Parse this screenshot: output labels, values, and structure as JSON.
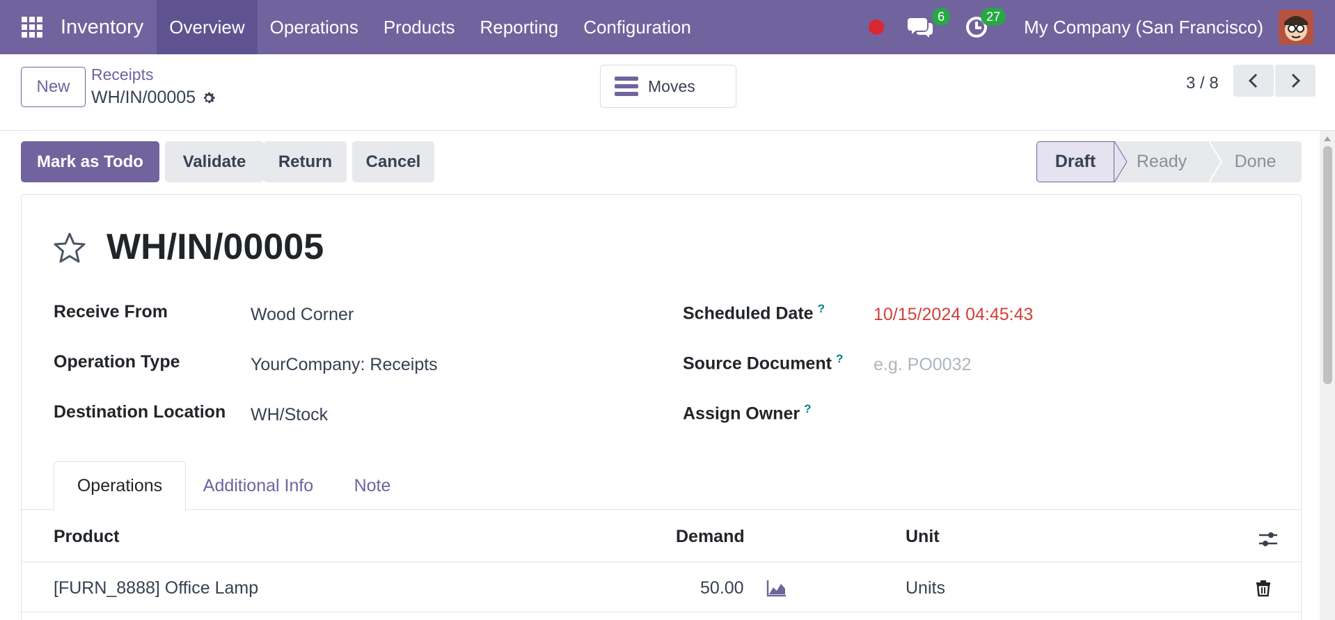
{
  "navbar": {
    "apps_icon": "apps-grid-icon",
    "app_name": "Inventory",
    "menu": [
      "Overview",
      "Operations",
      "Products",
      "Reporting",
      "Configuration"
    ],
    "active_menu": "Overview",
    "messages_count": "6",
    "activities_count": "27",
    "company": "My Company (San Francisco)",
    "brand_color": "#71639e"
  },
  "control_panel": {
    "new_label": "New",
    "breadcrumb_parent": "Receipts",
    "breadcrumb_current": "WH/IN/00005",
    "moves_label": "Moves",
    "pager": "3 / 8"
  },
  "actions": {
    "mark_todo": "Mark as Todo",
    "validate": "Validate",
    "return": "Return",
    "cancel": "Cancel"
  },
  "status": {
    "stages": [
      "Draft",
      "Ready",
      "Done"
    ],
    "current": "Draft"
  },
  "form": {
    "title": "WH/IN/00005",
    "fields": {
      "receive_from": {
        "label": "Receive From",
        "value": "Wood Corner"
      },
      "operation_type": {
        "label": "Operation Type",
        "value": "YourCompany: Receipts"
      },
      "destination_location": {
        "label": "Destination Location",
        "value": "WH/Stock"
      },
      "scheduled_date": {
        "label": "Scheduled Date",
        "value": "10/15/2024 04:45:43",
        "value_color": "#d23f3a"
      },
      "source_document": {
        "label": "Source Document",
        "placeholder": "e.g. PO0032"
      },
      "assign_owner": {
        "label": "Assign Owner",
        "value": ""
      }
    },
    "help_mark": "?"
  },
  "tabs": [
    "Operations",
    "Additional Info",
    "Note"
  ],
  "active_tab": "Operations",
  "table": {
    "headers": [
      "Product",
      "Demand",
      "Unit"
    ],
    "rows": [
      {
        "product": "[FURN_8888] Office Lamp",
        "demand": "50.00",
        "unit": "Units"
      }
    ]
  }
}
